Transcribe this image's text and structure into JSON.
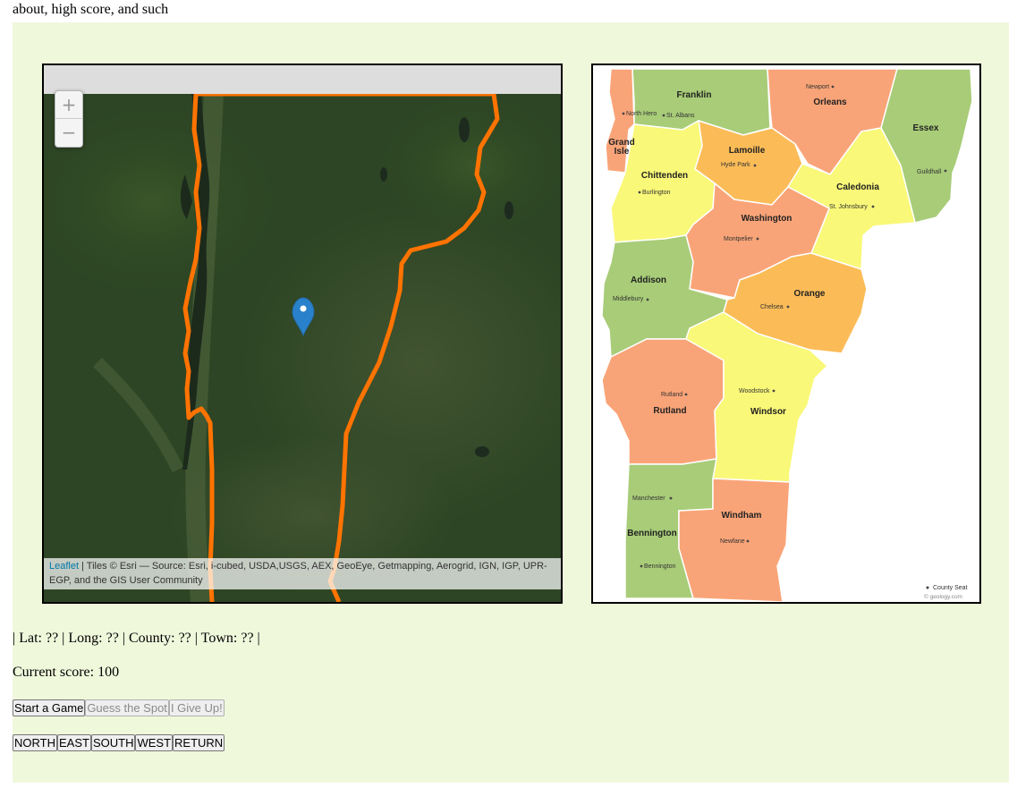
{
  "intro_text": "about, high score, and such",
  "map": {
    "zoom_in": "+",
    "zoom_out": "−",
    "attribution_link": "Leaflet",
    "attribution_text": " | Tiles © Esri — Source: Esri, i-cubed, USDA,USGS, AEX, GeoEye, Getmapping, Aerogrid, IGN, IGP, UPR-EGP, and the GIS User Community",
    "border_color": "#ff7300",
    "marker_color": "#2a81cb"
  },
  "county_map": {
    "counties": {
      "franklin": "Franklin",
      "orleans": "Orleans",
      "essex": "Essex",
      "grand_isle_1": "Grand",
      "grand_isle_2": "Isle",
      "lamoille": "Lamoille",
      "chittenden": "Chittenden",
      "caledonia": "Caledonia",
      "washington": "Washington",
      "addison": "Addison",
      "orange": "Orange",
      "rutland": "Rutland",
      "windsor": "Windsor",
      "bennington": "Bennington",
      "windham": "Windham"
    },
    "towns": {
      "newport": "Newport",
      "north_hero": "North Hero",
      "st_albans": "St. Albans",
      "hyde_park": "Hyde Park",
      "guildhall": "Guildhall",
      "burlington": "Burlington",
      "st_johnsbury": "St. Johnsbury",
      "montpelier": "Montpelier",
      "middlebury": "Middlebury",
      "chelsea": "Chelsea",
      "woodstock": "Woodstock",
      "rutland_town": "Rutland",
      "manchester": "Manchester",
      "newfane": "Newfane",
      "bennington_town": "Bennington"
    },
    "legend": "County Seat",
    "credit": "© geology.com",
    "colors": {
      "green": "#a8cc78",
      "orange": "#f9a478",
      "yellow": "#f9f878",
      "gold": "#fbbc58"
    }
  },
  "status": "| Lat: ?? | Long: ?? | County: ?? | Town: ?? |",
  "score": "Current score: 100",
  "buttons": {
    "start": "Start a Game",
    "guess": "Guess the Spot",
    "give_up": "I Give Up!",
    "north": "NORTH",
    "east": "EAST",
    "south": "SOUTH",
    "west": "WEST",
    "return": "RETURN"
  }
}
